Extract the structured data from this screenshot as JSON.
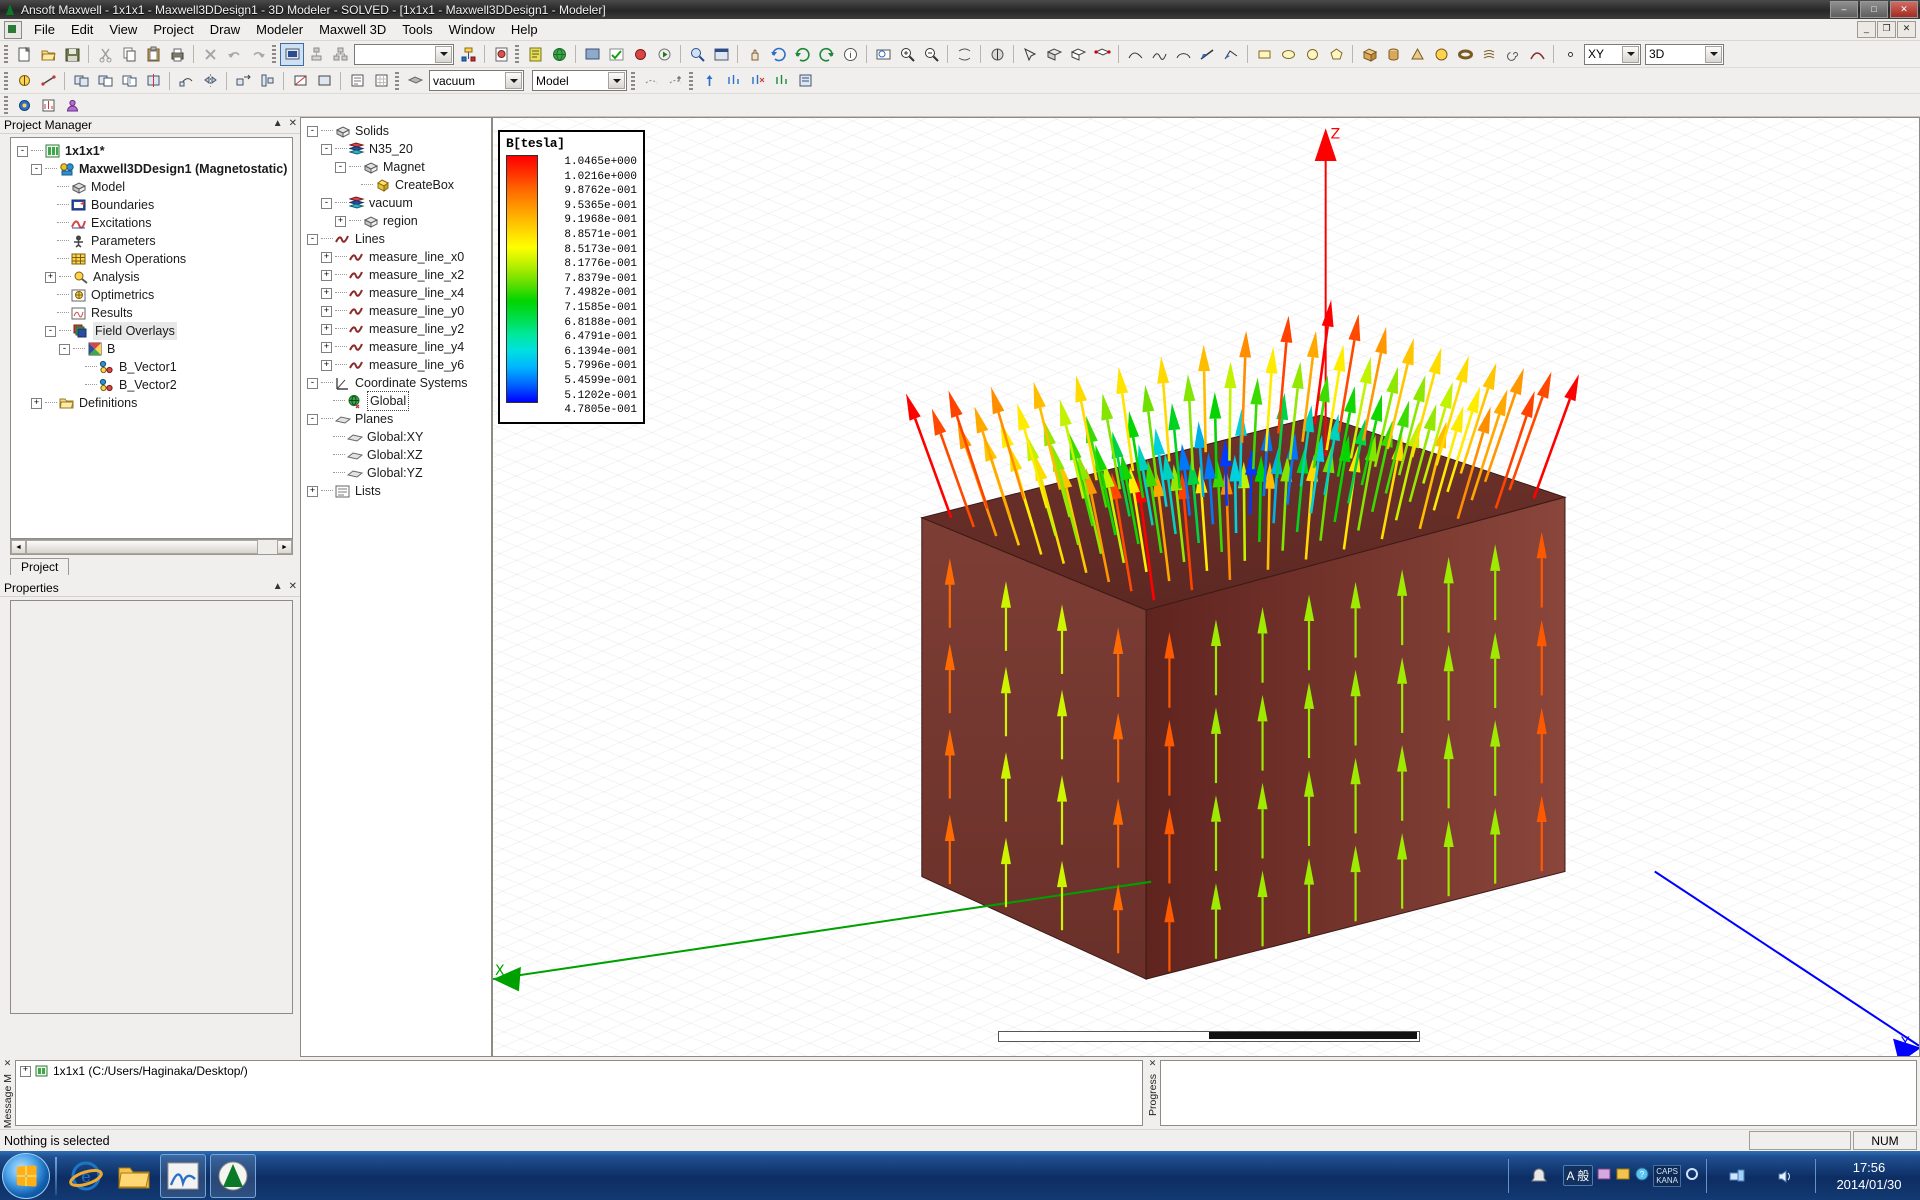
{
  "window": {
    "title": "Ansoft Maxwell - 1x1x1 - Maxwell3DDesign1 - 3D Modeler - SOLVED - [1x1x1 - Maxwell3DDesign1 - Modeler]",
    "minimize_label": "–",
    "maximize_label": "□",
    "close_label": "✕",
    "mdi_minimize": "_",
    "mdi_restore": "❐",
    "mdi_close": "✕"
  },
  "menu": {
    "items": [
      "File",
      "Edit",
      "View",
      "Project",
      "Draw",
      "Modeler",
      "Maxwell 3D",
      "Tools",
      "Window",
      "Help"
    ]
  },
  "toolbar": {
    "material_value": "vacuum",
    "model_value": "Model",
    "empty_combo_value": "",
    "plane_value": "XY",
    "dim_value": "3D"
  },
  "project_manager": {
    "panel_title": "Project Manager",
    "collapse_label": "▲",
    "close_label": "✕",
    "tab_label": "Project",
    "tree": [
      {
        "label": "1x1x1*",
        "depth": 0,
        "expander": "-",
        "icon": "project-icon",
        "bold": true
      },
      {
        "label": "Maxwell3DDesign1 (Magnetostatic)",
        "depth": 1,
        "expander": "-",
        "icon": "design-icon",
        "bold": true
      },
      {
        "label": "Model",
        "depth": 2,
        "expander": "",
        "icon": "model-icon",
        "bold": false
      },
      {
        "label": "Boundaries",
        "depth": 2,
        "expander": "",
        "icon": "boundaries-icon",
        "bold": false
      },
      {
        "label": "Excitations",
        "depth": 2,
        "expander": "",
        "icon": "excitations-icon",
        "bold": false
      },
      {
        "label": "Parameters",
        "depth": 2,
        "expander": "",
        "icon": "parameters-icon",
        "bold": false
      },
      {
        "label": "Mesh Operations",
        "depth": 2,
        "expander": "",
        "icon": "mesh-icon",
        "bold": false
      },
      {
        "label": "Analysis",
        "depth": 2,
        "expander": "+",
        "icon": "analysis-icon",
        "bold": false
      },
      {
        "label": "Optimetrics",
        "depth": 2,
        "expander": "",
        "icon": "optimetrics-icon",
        "bold": false
      },
      {
        "label": "Results",
        "depth": 2,
        "expander": "",
        "icon": "results-icon",
        "bold": false
      },
      {
        "label": "Field Overlays",
        "depth": 2,
        "expander": "-",
        "icon": "field-overlays-icon",
        "bold": false,
        "selected": true
      },
      {
        "label": "B",
        "depth": 3,
        "expander": "-",
        "icon": "b-field-icon",
        "bold": false
      },
      {
        "label": "B_Vector1",
        "depth": 4,
        "expander": "",
        "icon": "vector-plot-icon",
        "bold": false
      },
      {
        "label": "B_Vector2",
        "depth": 4,
        "expander": "",
        "icon": "vector-plot-icon",
        "bold": false
      },
      {
        "label": "Definitions",
        "depth": 1,
        "expander": "+",
        "icon": "folder-icon",
        "bold": false
      }
    ]
  },
  "properties": {
    "panel_title": "Properties",
    "collapse_label": "▲",
    "close_label": "✕"
  },
  "model_tree": {
    "nodes": [
      {
        "label": "Solids",
        "depth": 0,
        "expander": "-",
        "icon": "solid-icon"
      },
      {
        "label": "N35_20",
        "depth": 1,
        "expander": "-",
        "icon": "material-stack-icon"
      },
      {
        "label": "Magnet",
        "depth": 2,
        "expander": "-",
        "icon": "solid-icon"
      },
      {
        "label": "CreateBox",
        "depth": 3,
        "expander": "",
        "icon": "createbox-icon"
      },
      {
        "label": "vacuum",
        "depth": 1,
        "expander": "-",
        "icon": "material-stack-icon"
      },
      {
        "label": "region",
        "depth": 2,
        "expander": "+",
        "icon": "solid-icon"
      },
      {
        "label": "Lines",
        "depth": 0,
        "expander": "-",
        "icon": "line-icon"
      },
      {
        "label": "measure_line_x0",
        "depth": 1,
        "expander": "+",
        "icon": "line-icon"
      },
      {
        "label": "measure_line_x2",
        "depth": 1,
        "expander": "+",
        "icon": "line-icon"
      },
      {
        "label": "measure_line_x4",
        "depth": 1,
        "expander": "+",
        "icon": "line-icon"
      },
      {
        "label": "measure_line_y0",
        "depth": 1,
        "expander": "+",
        "icon": "line-icon"
      },
      {
        "label": "measure_line_y2",
        "depth": 1,
        "expander": "+",
        "icon": "line-icon"
      },
      {
        "label": "measure_line_y4",
        "depth": 1,
        "expander": "+",
        "icon": "line-icon"
      },
      {
        "label": "measure_line_y6",
        "depth": 1,
        "expander": "+",
        "icon": "line-icon"
      },
      {
        "label": "Coordinate Systems",
        "depth": 0,
        "expander": "-",
        "icon": "coordinate-system-icon"
      },
      {
        "label": "Global",
        "depth": 1,
        "expander": "",
        "icon": "global-cs-icon",
        "selected": true
      },
      {
        "label": "Planes",
        "depth": 0,
        "expander": "-",
        "icon": "plane-icon"
      },
      {
        "label": "Global:XY",
        "depth": 1,
        "expander": "",
        "icon": "plane-icon"
      },
      {
        "label": "Global:XZ",
        "depth": 1,
        "expander": "",
        "icon": "plane-icon"
      },
      {
        "label": "Global:YZ",
        "depth": 1,
        "expander": "",
        "icon": "plane-icon"
      },
      {
        "label": "Lists",
        "depth": 0,
        "expander": "+",
        "icon": "lists-icon"
      }
    ]
  },
  "viewport": {
    "legend": {
      "title": "B[tesla]",
      "values": [
        "1.0465e+000",
        "1.0216e+000",
        "9.8762e-001",
        "9.5365e-001",
        "9.1968e-001",
        "8.8571e-001",
        "8.5173e-001",
        "8.1776e-001",
        "7.8379e-001",
        "7.4982e-001",
        "7.1585e-001",
        "6.8188e-001",
        "6.4791e-001",
        "6.1394e-001",
        "5.7996e-001",
        "5.4599e-001",
        "5.1202e-001",
        "4.7805e-001"
      ]
    },
    "axes": {
      "x_label": "X",
      "y_label": "Y",
      "z_label": "Z",
      "x_color": "#00a000",
      "y_color": "#0000ff",
      "z_color": "#ff0000"
    },
    "magnet_color": "#7a3b33"
  },
  "message_window": {
    "vertical_label": "Message M",
    "close_label": "✕",
    "expander": "+",
    "entry": "1x1x1 (C:/Users/Haginaka/Desktop/)"
  },
  "progress_window": {
    "vertical_label": "Progress",
    "close_label": "✕"
  },
  "status_bar": {
    "message": "Nothing is selected",
    "num_indicator": "NUM"
  },
  "taskbar": {
    "items": [
      {
        "name": "internet-explorer",
        "label": "e"
      },
      {
        "name": "file-explorer",
        "label": ""
      },
      {
        "name": "maxwell-app",
        "label": ""
      },
      {
        "name": "ansoft-app",
        "label": ""
      }
    ],
    "tray": {
      "ime_mode": "A 般",
      "caps_line1": "CAPS",
      "caps_line2": "KANA",
      "time": "17:56",
      "date": "2014/01/30"
    }
  }
}
